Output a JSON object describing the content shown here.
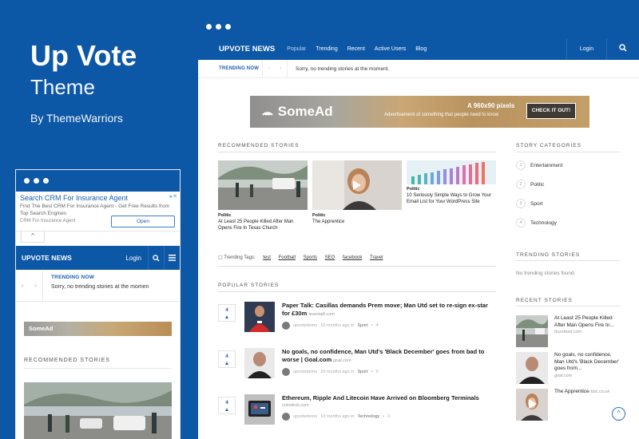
{
  "promo": {
    "title": "Up Vote",
    "subtitle": "Theme",
    "author": "By ThemeWarriors"
  },
  "mobile": {
    "ad": {
      "headline": "Search CRM For Insurance Agent",
      "description": "Find The Best CRM For Insurance Agent - Get Free Results from Top Search Engines",
      "url": "CRM For Insurance Agent",
      "button": "Open"
    },
    "toggle": "^",
    "nav": {
      "brand": "UPVOTE NEWS",
      "login": "Login"
    },
    "trending": {
      "label": "TRENDING NOW",
      "message": "Sorry, no trending stories at the momen"
    },
    "banner_logo": "SomeAd",
    "section": "RECOMMENDED STORIES"
  },
  "desktop": {
    "nav": {
      "brand": "UPVOTE NEWS",
      "items": [
        "Popular",
        "Trending",
        "Recent",
        "Active Users",
        "Blog"
      ],
      "login": "Login"
    },
    "trending": {
      "label": "TRENDING NOW",
      "message": "Sorry, no trending stories at the moment."
    },
    "banner": {
      "logo": "SomeAd",
      "size": "A 960x90 pixels",
      "text": "Advertisement of something that people need to know",
      "cta": "CHECK IT OUT!"
    },
    "recommended": {
      "title": "RECOMMENDED STORIES",
      "items": [
        {
          "category": "Politic",
          "title": "At Least 25 People Killed After Man Opens Fire In Texas Church"
        },
        {
          "category": "Politic",
          "title": "The Apprentice"
        },
        {
          "category": "Politic",
          "title": "10 Seriously Simple Ways to Grow Your Email List for Your WordPress Site"
        }
      ]
    },
    "tags": {
      "label": "Trending Tags:",
      "items": [
        "test",
        "Football",
        "Sports",
        "SEO",
        "facebook",
        "Travel"
      ]
    },
    "popular": {
      "title": "POPULAR STORIES",
      "items": [
        {
          "votes": "4",
          "title": "Paper Talk: Casillas demands Prem move; Man Utd set to re-sign ex-star for £30m",
          "source": "teamtalk.com",
          "user": "upvotedemo",
          "time": "10 months ago in",
          "category": "Sport",
          "count": "4"
        },
        {
          "votes": "4",
          "title": "No goals, no confidence, Man Utd's 'Black December' goes from bad to worse | Goal.com",
          "source": "goal.com",
          "user": "upvotedemo",
          "time": "10 months ago in",
          "category": "Sport",
          "count": "0"
        },
        {
          "votes": "4",
          "title": "Ethereum, Ripple And Litecoin Have Arrived on Bloomberg Terminals",
          "source": "coindesk.com",
          "user": "upvotedemo",
          "time": "10 months ago in",
          "category": "Technology",
          "count": "0"
        }
      ]
    },
    "sidebar": {
      "categories_title": "STORY CATEGORIES",
      "categories": [
        {
          "n": "1",
          "name": "Entertainment"
        },
        {
          "n": "2",
          "name": "Politic"
        },
        {
          "n": "3",
          "name": "Sport"
        },
        {
          "n": "4",
          "name": "Technology"
        }
      ],
      "trending_title": "TRENDING STORIES",
      "trending_empty": "No trending stories found.",
      "recent_title": "RECENT STORIES",
      "recent": [
        {
          "title": "At Least 25 People Killed After Man Opens Fire In...",
          "source": "buzzfeed.com"
        },
        {
          "title": "No goals, no confidence, Man Utd's 'Black December' goes from...",
          "source": "goal.com"
        },
        {
          "title": "The Apprentice",
          "source": "bbc.co.uk"
        }
      ]
    },
    "back_to_top": "^"
  }
}
